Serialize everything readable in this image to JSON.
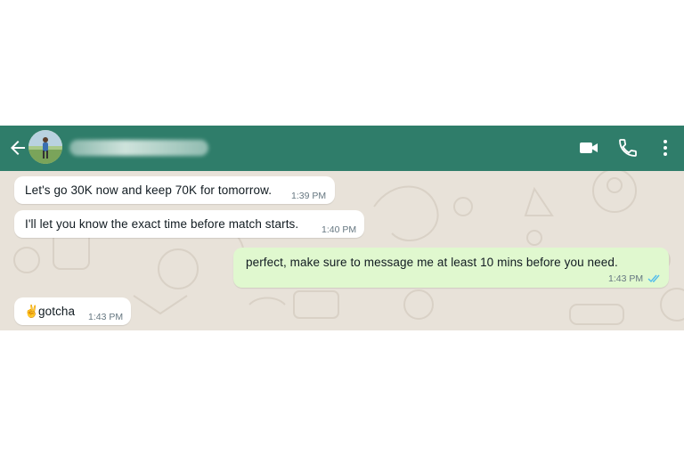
{
  "header": {
    "contact_name": "●●●● ●●● ●●●●●",
    "back_icon": "arrow-left-icon",
    "video_icon": "video-camera-icon",
    "call_icon": "phone-icon",
    "menu_icon": "kebab-menu-icon",
    "bg_color": "#2f7d6a"
  },
  "messages": [
    {
      "direction": "incoming",
      "text": "Let's go 30K now and keep 70K for tomorrow.",
      "time": "1:39 PM"
    },
    {
      "direction": "incoming",
      "text": "I'll let you know the exact time before match starts.",
      "time": "1:40 PM"
    },
    {
      "direction": "outgoing",
      "text": "perfect, make sure to message me at least 10 mins before you need.",
      "time": "1:43 PM",
      "status": "read"
    },
    {
      "direction": "incoming",
      "emoji": "✌️",
      "text": "gotcha",
      "time": "1:43 PM"
    }
  ],
  "colors": {
    "incoming_bubble": "#ffffff",
    "outgoing_bubble": "#e0f8cf",
    "chat_bg": "#e8e2d9",
    "read_ticks": "#53bdeb"
  }
}
